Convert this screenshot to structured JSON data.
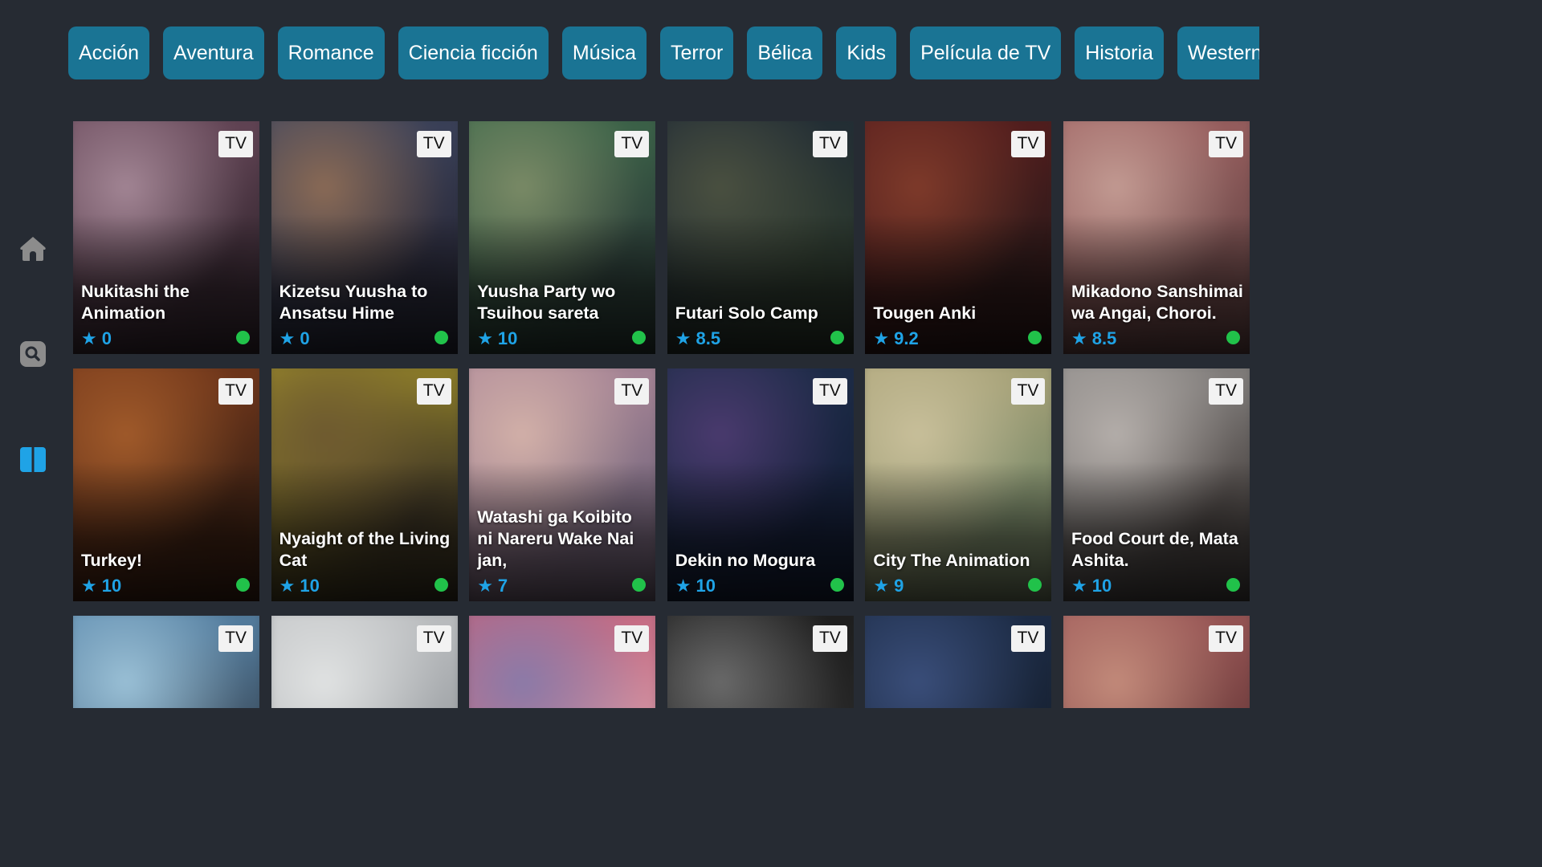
{
  "genres": [
    "Acción",
    "Aventura",
    "Romance",
    "Ciencia ficción",
    "Música",
    "Terror",
    "Bélica",
    "Kids",
    "Película de TV",
    "Historia",
    "Western"
  ],
  "sidebar": {
    "items": [
      {
        "icon": "home-icon"
      },
      {
        "icon": "search-icon"
      },
      {
        "icon": "library-icon",
        "active": true
      }
    ],
    "icon_color": "#8c8c8c",
    "active_color": "#1fa3e6"
  },
  "accent": "#1a7494",
  "rating_color": "#1fa3e6",
  "status_color": "#21c24a",
  "cards": [
    {
      "title": "Nukitashi the Animation",
      "rating": "0",
      "badge": "TV",
      "colors": [
        "#6b4a5c",
        "#a28594",
        "#3a2a34"
      ]
    },
    {
      "title": "Kizetsu Yuusha to Ansatsu Hime",
      "rating": "0",
      "badge": "TV",
      "colors": [
        "#3e4660",
        "#8a6a55",
        "#2a2a3a"
      ]
    },
    {
      "title": "Yuusha Party wo Tsuihou sareta",
      "rating": "10",
      "badge": "TV",
      "colors": [
        "#3f6b4c",
        "#7a8a66",
        "#2c3d38"
      ]
    },
    {
      "title": "Futari Solo Camp",
      "rating": "8.5",
      "badge": "TV",
      "colors": [
        "#1f2a36",
        "#4a5040",
        "#2e3a2e"
      ]
    },
    {
      "title": "Tougen Anki",
      "rating": "9.2",
      "badge": "TV",
      "colors": [
        "#5a1e1e",
        "#7e3a2a",
        "#2e1a1a"
      ]
    },
    {
      "title": "Mikadono Sanshimai wa Angai, Choroi.",
      "rating": "8.5",
      "badge": "TV",
      "colors": [
        "#a06262",
        "#c29a92",
        "#6e4a4a"
      ]
    },
    {
      "title": "Turkey!",
      "rating": "10",
      "badge": "TV",
      "colors": [
        "#7a3a1c",
        "#a05a2a",
        "#3e2214"
      ]
    },
    {
      "title": "Nyaight of the Living Cat",
      "rating": "10",
      "badge": "TV",
      "colors": [
        "#a08f2a",
        "#6e5a30",
        "#3a3224"
      ]
    },
    {
      "title": "Watashi ga Koibito ni Nareru Wake Nai jan,",
      "rating": "7",
      "badge": "TV",
      "colors": [
        "#b08a9a",
        "#d2b0a8",
        "#7a6a80"
      ]
    },
    {
      "title": "Dekin no Mogura",
      "rating": "10",
      "badge": "TV",
      "colors": [
        "#1e2e4a",
        "#4a3a6e",
        "#16203a"
      ]
    },
    {
      "title": "City The Animation",
      "rating": "9",
      "badge": "TV",
      "colors": [
        "#b0a67a",
        "#c8bf9a",
        "#7a8a6a"
      ]
    },
    {
      "title": "Food Court de, Mata Ashita.",
      "rating": "10",
      "badge": "TV",
      "colors": [
        "#8f8c8a",
        "#b4aeaa",
        "#4c4644"
      ]
    },
    {
      "title": "",
      "rating": "",
      "badge": "TV",
      "colors": [
        "#5a8ab0",
        "#9ac0d6",
        "#3a4a5a"
      ]
    },
    {
      "title": "",
      "rating": "",
      "badge": "TV",
      "colors": [
        "#c2c4c6",
        "#e0e2e2",
        "#9a9ea2"
      ]
    },
    {
      "title": "",
      "rating": "",
      "badge": "TV",
      "colors": [
        "#c2607a",
        "#8a7aa8",
        "#d29aa8"
      ]
    },
    {
      "title": "",
      "rating": "",
      "badge": "TV",
      "colors": [
        "#1a1a1a",
        "#6a6a6a",
        "#2a2a2a"
      ]
    },
    {
      "title": "",
      "rating": "",
      "badge": "TV",
      "colors": [
        "#1e2e4a",
        "#3a4e7a",
        "#162030"
      ]
    },
    {
      "title": "",
      "rating": "",
      "badge": "TV",
      "colors": [
        "#a05a5a",
        "#c28a7a",
        "#6a3a3a"
      ]
    }
  ]
}
